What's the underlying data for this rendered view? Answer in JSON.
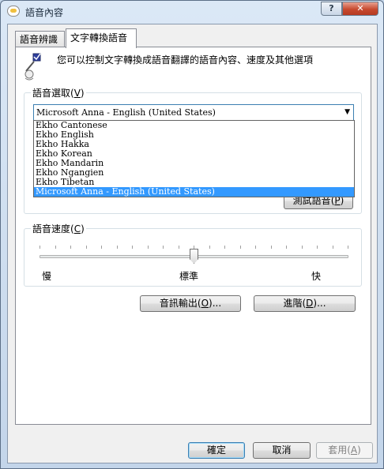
{
  "window": {
    "title": "語音內容",
    "help_label": "?",
    "close_label": "✕"
  },
  "tabs": [
    {
      "label": "語音辨識"
    },
    {
      "label": "文字轉換語音"
    }
  ],
  "intro": {
    "text": "您可以控制文字轉換成語音翻譯的語音內容、速度及其他選項",
    "icon": "speech-pen-icon"
  },
  "voice_selection": {
    "label": "語音選取",
    "hotkey": "V",
    "selected": "Microsoft Anna - English (United States)",
    "options": [
      "Ekho Cantonese",
      "Ekho English",
      "Ekho Hakka",
      "Ekho Korean",
      "Ekho Mandarin",
      "Ekho Ngangien",
      "Ekho Tibetan",
      "Microsoft Anna - English (United States)"
    ],
    "test_button": {
      "label": "測試語音",
      "hotkey": "P"
    }
  },
  "voice_speed": {
    "label": "語音速度",
    "hotkey": "C",
    "slow_label": "慢",
    "normal_label": "標準",
    "fast_label": "快",
    "position_fraction": 0.5
  },
  "buttons": {
    "audio_output": {
      "label": "音訊輸出",
      "hotkey": "O"
    },
    "advanced": {
      "label": "進階",
      "hotkey": "D"
    },
    "ok": "確定",
    "cancel": "取消",
    "apply": {
      "label": "套用",
      "hotkey": "A"
    }
  },
  "colors": {
    "selection": "#3399ff",
    "close_button": "#c74a2f"
  }
}
